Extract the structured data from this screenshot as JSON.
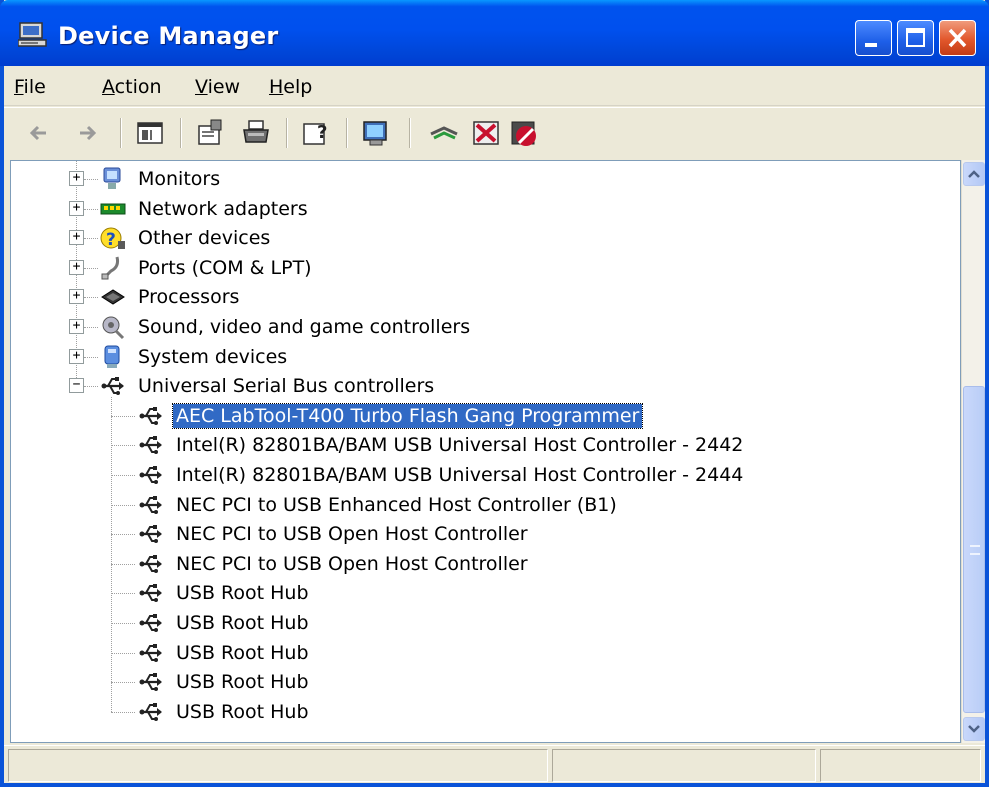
{
  "window": {
    "title": "Device Manager",
    "title_icon": "computer-icon",
    "controls": [
      "minimize",
      "maximize",
      "close"
    ]
  },
  "menu": [
    {
      "label": "File",
      "mnemonic": "F",
      "rest": "ile"
    },
    {
      "label": "Action",
      "mnemonic": "A",
      "rest": "ction"
    },
    {
      "label": "View",
      "mnemonic": "V",
      "rest": "iew"
    },
    {
      "label": "Help",
      "mnemonic": "H",
      "rest": "elp"
    }
  ],
  "toolbar": {
    "icons": [
      "back-arrow-icon",
      "forward-arrow-icon",
      "show-hide-console-tree-icon",
      "properties-icon",
      "print-icon",
      "help-icon",
      "scan-hardware-icon",
      "update-driver-icon",
      "uninstall-icon",
      "disable-icon"
    ]
  },
  "tree": {
    "categories": [
      {
        "label": "Monitors",
        "icon": "monitor-icon",
        "expanded": false
      },
      {
        "label": "Network adapters",
        "icon": "network-card-icon",
        "expanded": false
      },
      {
        "label": "Other devices",
        "icon": "unknown-device-icon",
        "expanded": false
      },
      {
        "label": "Ports (COM & LPT)",
        "icon": "port-icon",
        "expanded": false
      },
      {
        "label": "Processors",
        "icon": "processor-icon",
        "expanded": false
      },
      {
        "label": "Sound, video and game controllers",
        "icon": "sound-icon",
        "expanded": false
      },
      {
        "label": "System devices",
        "icon": "system-device-icon",
        "expanded": false
      },
      {
        "label": "Universal Serial Bus controllers",
        "icon": "usb-icon",
        "expanded": true
      }
    ],
    "usb_children": [
      {
        "label": "AEC LabTool-T400 Turbo Flash Gang Programmer",
        "selected": true
      },
      {
        "label": "Intel(R) 82801BA/BAM USB Universal Host Controller - 2442",
        "selected": false
      },
      {
        "label": "Intel(R) 82801BA/BAM USB Universal Host Controller - 2444",
        "selected": false
      },
      {
        "label": "NEC PCI to USB Enhanced Host Controller (B1)",
        "selected": false
      },
      {
        "label": "NEC PCI to USB Open Host Controller",
        "selected": false
      },
      {
        "label": "NEC PCI to USB Open Host Controller",
        "selected": false
      },
      {
        "label": "USB Root Hub",
        "selected": false
      },
      {
        "label": "USB Root Hub",
        "selected": false
      },
      {
        "label": "USB Root Hub",
        "selected": false
      },
      {
        "label": "USB Root Hub",
        "selected": false
      },
      {
        "label": "USB Root Hub",
        "selected": false
      }
    ],
    "expander_collapsed": "+",
    "expander_expanded": "−"
  },
  "scrollbar": {
    "up_glyph": "⌃",
    "down_glyph": "⌄"
  },
  "colors": {
    "titlebar": "#0050ee",
    "selection": "#316ac5",
    "window_bg": "#ece9d8"
  }
}
